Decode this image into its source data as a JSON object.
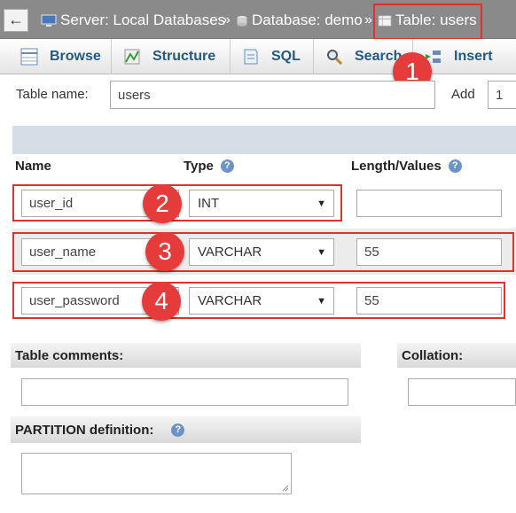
{
  "breadcrumb": {
    "back": "←",
    "server": "Server: Local Databases",
    "database": "Database: demo",
    "table": "Table: users",
    "separator": "»"
  },
  "tabs": [
    {
      "label": "Browse",
      "icon": "browse-icon"
    },
    {
      "label": "Structure",
      "icon": "structure-icon"
    },
    {
      "label": "SQL",
      "icon": "sql-icon"
    },
    {
      "label": "Search",
      "icon": "search-icon"
    },
    {
      "label": "Insert",
      "icon": "insert-icon"
    }
  ],
  "table_name": {
    "label": "Table name:",
    "value": "users"
  },
  "add": {
    "label": "Add",
    "value": "1"
  },
  "columns_header": {
    "name": "Name",
    "type": "Type",
    "length": "Length/Values",
    "help": "?"
  },
  "columns": [
    {
      "name": "user_id",
      "type": "INT",
      "length": "",
      "badge": "2"
    },
    {
      "name": "user_name",
      "type": "VARCHAR",
      "length": "55",
      "badge": "3"
    },
    {
      "name": "user_password",
      "type": "VARCHAR",
      "length": "55",
      "badge": "4"
    }
  ],
  "badge1": "1",
  "table_comments": {
    "label": "Table comments:",
    "value": ""
  },
  "collation": {
    "label": "Collation:"
  },
  "partition": {
    "label": "PARTITION definition:",
    "help": "?"
  },
  "colors": {
    "accent_red": "#e0312e",
    "tab_text": "#235a81",
    "header_bar": "#8a8a8a"
  }
}
